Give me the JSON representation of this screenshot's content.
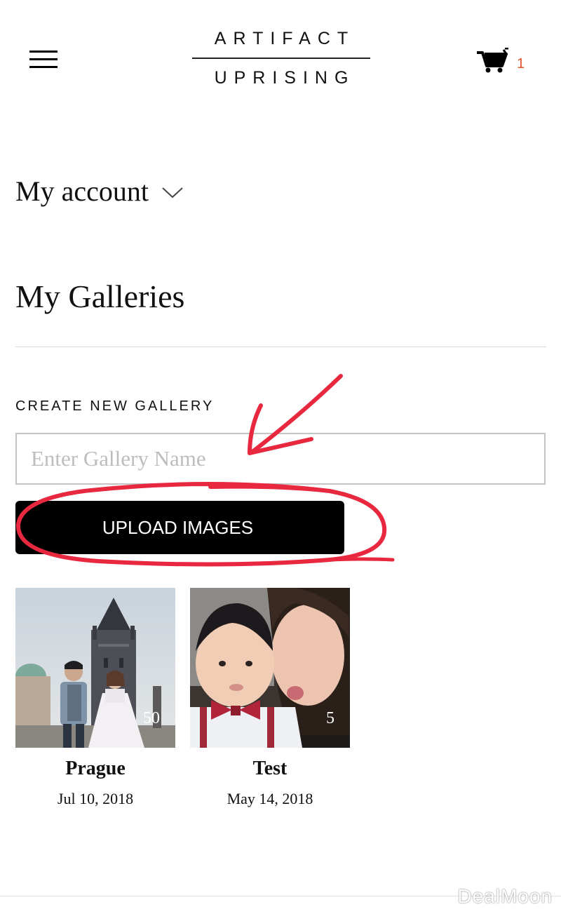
{
  "header": {
    "logo_top": "ARTIFACT",
    "logo_bottom": "UPRISING",
    "cart_count": "1",
    "accent_color": "#e0532a"
  },
  "account": {
    "label": "My account"
  },
  "galleries": {
    "title": "My Galleries",
    "create_label": "CREATE NEW GALLERY",
    "input_placeholder": "Enter Gallery Name",
    "input_value": "",
    "upload_label": "UPLOAD IMAGES",
    "items": [
      {
        "name": "Prague",
        "date": "Jul 10, 2018",
        "count": "50"
      },
      {
        "name": "Test",
        "date": "May 14, 2018",
        "count": "5"
      }
    ]
  },
  "watermark": "DealMoon",
  "annotation_color": "#e8283f"
}
